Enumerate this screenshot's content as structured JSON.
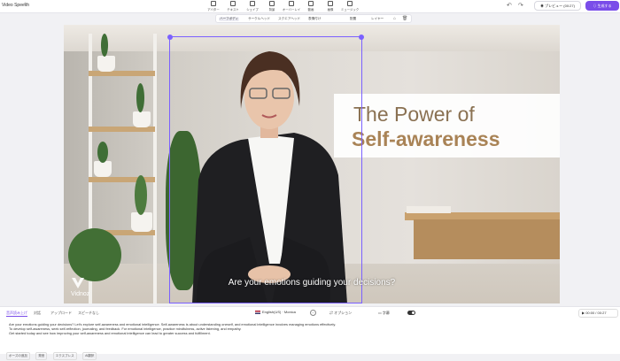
{
  "app": {
    "title": "Video Speech",
    "edit_icon": "pencil-icon"
  },
  "toolbar": {
    "tools": [
      {
        "label": "アバター",
        "icon": "avatar-icon"
      },
      {
        "label": "テキスト",
        "icon": "text-icon"
      },
      {
        "label": "シェイプ",
        "icon": "shape-icon"
      },
      {
        "label": "背景",
        "icon": "background-icon"
      },
      {
        "label": "オーバーレイ",
        "icon": "overlay-icon"
      },
      {
        "label": "動画",
        "icon": "video-icon"
      },
      {
        "label": "画像",
        "icon": "image-icon"
      },
      {
        "label": "ミュージック",
        "icon": "music-icon"
      }
    ],
    "undo_icon": "undo-icon",
    "redo_icon": "redo-icon",
    "preview_label": "プレビュー (00:27)",
    "generate_label": "生成する"
  },
  "subbar": {
    "items": [
      {
        "label": "ハーフボディ",
        "active": true
      },
      {
        "label": "サークルヘッド",
        "active": false
      },
      {
        "label": "スクエアヘッド",
        "active": false
      },
      {
        "label": "表情付け",
        "active": false
      }
    ],
    "arrange_label": "配置",
    "layer_label": "レイヤー"
  },
  "scene": {
    "title_line1": "The Power of",
    "title_line2": "Self-awareness",
    "subtitle": "Are your emotions guiding your decisions?",
    "logo_text": "Vidnoz",
    "accent": "#7b61ff"
  },
  "bottom": {
    "tabs": [
      {
        "label": "音声読み上げ",
        "active": true
      },
      {
        "label": "対話",
        "active": false
      },
      {
        "label": "アップロード",
        "active": false
      },
      {
        "label": "スピーチなし",
        "active": false
      }
    ],
    "voice_label": "English(US) · Monica",
    "options_label": "オプション",
    "subtitle_label": "字幕",
    "time": "00:00 / 00:27",
    "script_lines": [
      "Are your emotions guiding your decisions? Let's explore self-awareness and emotional intelligence. Self-awareness is about understanding oneself, and emotional intelligence involves managing emotions effectively.",
      "To develop self-awareness, seek self-reflection, journaling, and feedback. For emotional intelligence, practice mindfulness, active listening, and empathy.",
      "Get started today and see how improving your self-awareness and emotional intelligence can lead to greater success and fulfillment."
    ],
    "chips": [
      "ポーズの追加",
      "発音",
      "エクスプレス",
      "AI翻訳"
    ]
  }
}
